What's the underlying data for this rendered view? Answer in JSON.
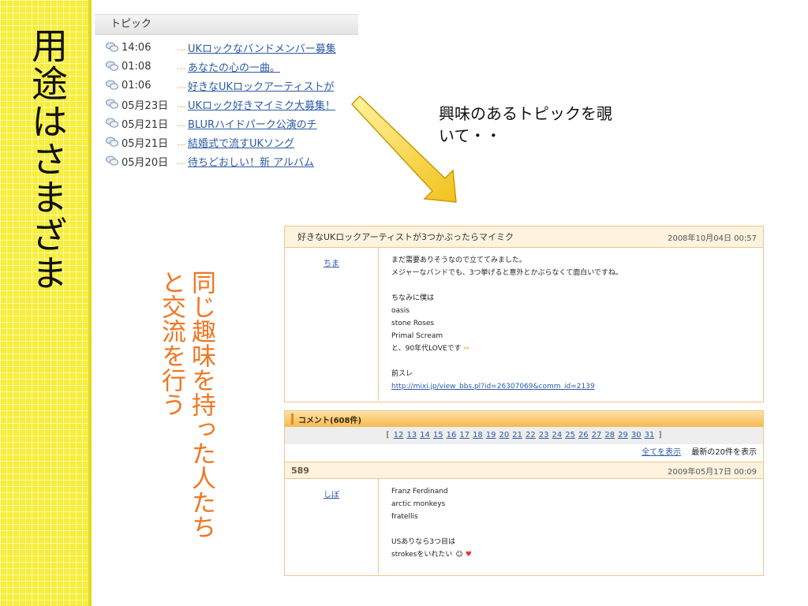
{
  "slide": {
    "title": "用途はさまざま",
    "side_caption_line1": "同じ趣味を持った人たち",
    "side_caption_line2": "と交流を行う",
    "callout_line1": "興味のあるトピックを覗",
    "callout_line2": "いて・・"
  },
  "colors": {
    "strip": "#f6ee3a",
    "caption": "#f07622",
    "link": "#2b5aa6",
    "panel_border": "#efc58c"
  },
  "topics": {
    "header": "トピック",
    "items": [
      {
        "time": "14:06",
        "title": "UKロックなバンドメンバー募集"
      },
      {
        "time": "01:08",
        "title": "あなたの心の一曲。"
      },
      {
        "time": "01:06",
        "title": "好きなUKロックアーティストが"
      },
      {
        "time": "05月23日",
        "title": "UKロック好きマイミク大募集！"
      },
      {
        "time": "05月21日",
        "title": "BLURハイドパーク公演のチ"
      },
      {
        "time": "05月21日",
        "title": "結婚式で流すUKソング"
      },
      {
        "time": "05月20日",
        "title": "待ちどおしい！新 アルバム"
      }
    ],
    "icon": "speech-bubble-icon",
    "dots": "…"
  },
  "thread": {
    "title": "好きなUKロックアーティストが3つかぶったらマイミク",
    "date": "2008年10月04日 00:57",
    "author": "ちま",
    "lines": [
      "まだ需要ありそうなので立ててみました。",
      "メジャーなバンドでも、3つ挙げると意外とかぶらなくて面白いですね。",
      "",
      "ちなみに僕は",
      "oasis",
      "stone Roses",
      "Primal Scream",
      "と、90年代LOVEです"
    ],
    "prev_label": "前スレ",
    "prev_link": "http://mixi.jp/view_bbs.pl?id=26307069&comm_id=2139"
  },
  "comments": {
    "header": "コメント(608件)",
    "pages": [
      "12",
      "13",
      "14",
      "15",
      "16",
      "17",
      "18",
      "19",
      "20",
      "21",
      "22",
      "23",
      "24",
      "25",
      "26",
      "27",
      "28",
      "29",
      "30",
      "31"
    ],
    "show_all": "全てを表示",
    "latest": "最新の20件を表示",
    "item": {
      "number": "589",
      "date": "2009年05月17日 00:09",
      "author": "しぼ",
      "lines": [
        "Franz Ferdinand",
        "arctic monkeys",
        "fratellis",
        "",
        "USありなら3つ目は",
        "strokesをいれたい"
      ]
    }
  }
}
